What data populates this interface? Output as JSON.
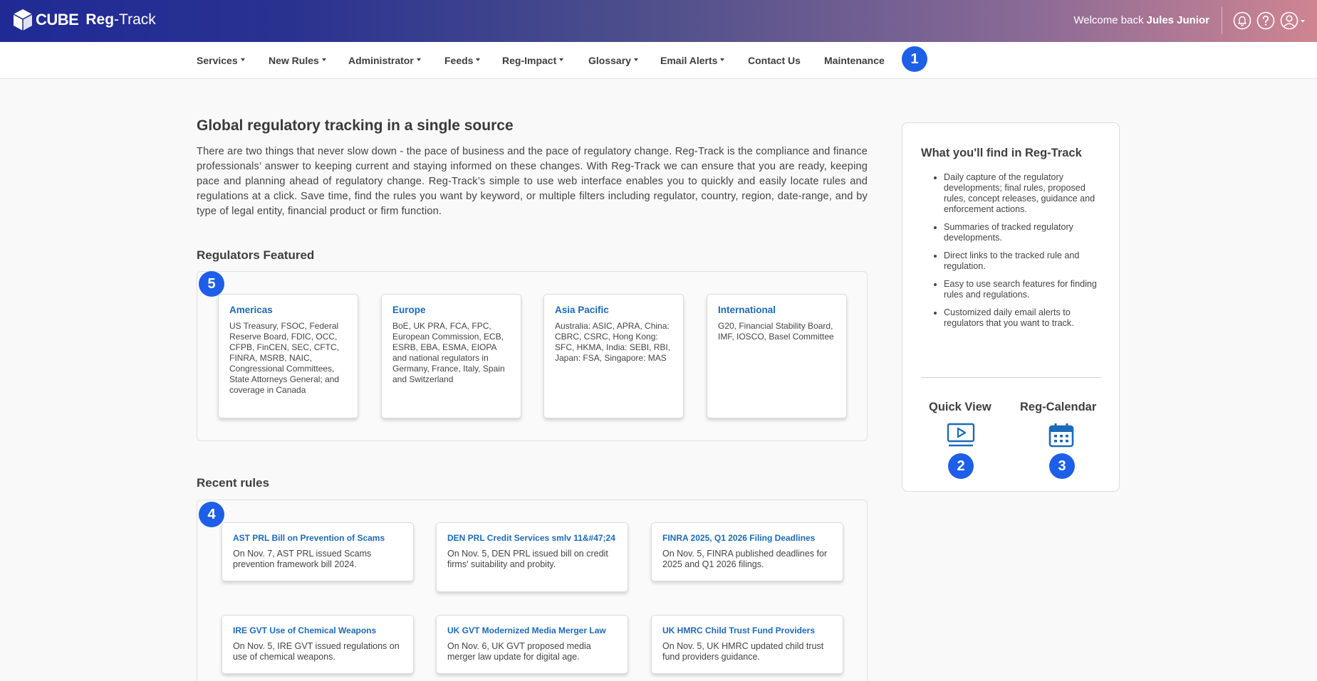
{
  "header": {
    "brand": "CUBE",
    "product_bold": "Reg",
    "product_rest": "-Track",
    "welcome_prefix": "Welcome back",
    "user_name": "Jules Junior",
    "icons": [
      "bell-icon",
      "help-icon",
      "user-icon"
    ]
  },
  "nav": {
    "items": [
      {
        "label": "Services",
        "dropdown": true
      },
      {
        "label": "New Rules",
        "dropdown": true
      },
      {
        "label": "Administrator",
        "dropdown": true
      },
      {
        "label": "Feeds",
        "dropdown": true
      },
      {
        "label": "Reg-Impact",
        "dropdown": true
      },
      {
        "label": "Glossary",
        "dropdown": true
      },
      {
        "label": "Email Alerts",
        "dropdown": true
      },
      {
        "label": "Contact Us",
        "dropdown": false
      },
      {
        "label": "Maintenance",
        "dropdown": false
      }
    ]
  },
  "badges": [
    "1",
    "2",
    "3",
    "4",
    "5"
  ],
  "main": {
    "title": "Global regulatory tracking in a single source",
    "intro": "There are two things that never slow down - the pace of business and the pace of regulatory change. Reg-Track is the compliance and finance professionals’ answer to keeping current and staying informed on these changes. With Reg-Track we can ensure that you are ready, keeping pace and planning ahead of regulatory change. Reg-Track’s simple to use web interface enables you to quickly and easily locate rules and regulations at a click. Save time, find the rules you want by keyword, or multiple filters including regulator, country, region, date-range, and by type of legal entity, financial product or firm function.",
    "regulators_title": "Regulators Featured",
    "regulators": [
      {
        "title": "Americas",
        "text": "US Treasury, FSOC, Federal Reserve Board, FDIC, OCC, CFPB, FinCEN, SEC, CFTC, FINRA, MSRB, NAIC, Congressional Committees, State Attorneys General; and coverage in Canada"
      },
      {
        "title": "Europe",
        "text": "BoE, UK PRA, FCA, FPC, European Commission, ECB, ESRB, EBA, ESMA, EIOPA and national regulators in Germany, France, Italy, Spain and Switzerland"
      },
      {
        "title": "Asia Pacific",
        "text": "Australia: ASIC, APRA, China: CBRC, CSRC, Hong Kong: SFC, HKMA, India: SEBI, RBI, Japan: FSA, Singapore: MAS"
      },
      {
        "title": "International",
        "text": "G20, Financial Stability Board, IMF, IOSCO, Basel Committee"
      }
    ],
    "rules_title": "Recent rules",
    "rules": [
      {
        "title": "AST PRL Bill on Prevention of Scams",
        "text": "On Nov. 7, AST PRL issued Scams prevention framework bill 2024."
      },
      {
        "title": "DEN PRL Credit Services smlv 11&#47;24",
        "text": "On Nov. 5, DEN PRL issued bill on credit firms' suitability and probity."
      },
      {
        "title": "FINRA 2025, Q1 2026 Filing Deadlines",
        "text": "On Nov. 5, FINRA published deadlines for 2025 and Q1 2026 filings."
      },
      {
        "title": "IRE GVT Use of Chemical Weapons",
        "text": "On Nov. 5, IRE GVT issued regulations on use of chemical weapons."
      },
      {
        "title": "UK GVT Modernized Media Merger Law",
        "text": "On Nov. 6, UK GVT proposed media merger law update for digital age."
      },
      {
        "title": "UK HMRC Child Trust Fund Providers",
        "text": "On Nov. 5, UK HMRC updated child trust fund providers guidance."
      }
    ]
  },
  "sidebar": {
    "title": "What you'll find in Reg-Track",
    "items": [
      "Daily capture of the regulatory developments; final rules, proposed rules, concept releases, guidance and enforcement actions.",
      "Summaries of tracked regulatory developments.",
      "Direct links to the tracked rule and regulation.",
      "Easy to use search features for finding rules and regulations.",
      "Customized daily email alerts to regulators that you want to track."
    ],
    "quick_view": "Quick View",
    "reg_calendar": "Reg-Calendar",
    "colors": {
      "accent": "#1d6ab8",
      "badge": "#1e5fe8"
    }
  }
}
